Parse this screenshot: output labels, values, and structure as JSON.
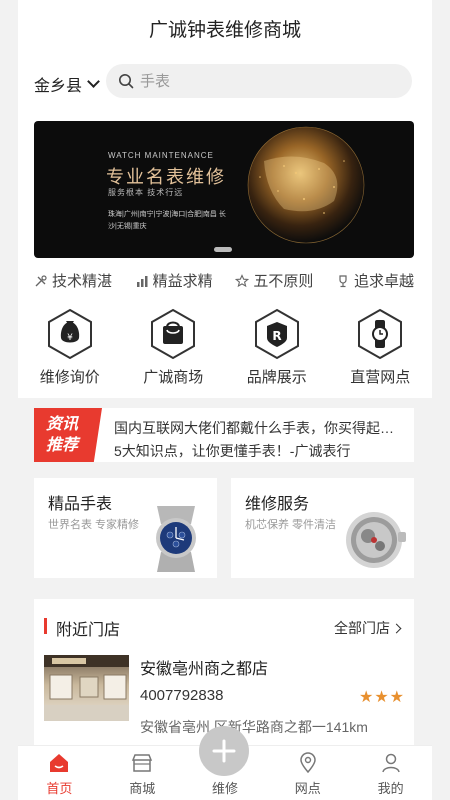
{
  "header": {
    "title": "广诚钟表维修商城"
  },
  "location": {
    "label": "金乡县"
  },
  "search": {
    "placeholder": "手表"
  },
  "banner": {
    "kicker": "WATCH MAINTENANCE",
    "title": "专业名表维修",
    "subtitle": "服务根本  技术行远",
    "cities": "珠海|广州|南宁|宁波|海口|合肥|南昌 长沙|无锡|重庆"
  },
  "features": [
    {
      "label": "技术精湛",
      "icon": "tools-icon"
    },
    {
      "label": "精益求精",
      "icon": "chart-icon"
    },
    {
      "label": "五不原则",
      "icon": "star-icon"
    },
    {
      "label": "追求卓越",
      "icon": "trophy-icon"
    }
  ],
  "quick_links": [
    {
      "label": "维修询价",
      "icon": "money-bag-icon"
    },
    {
      "label": "广诚商场",
      "icon": "shopping-bag-icon"
    },
    {
      "label": "品牌展示",
      "icon": "brand-r-icon"
    },
    {
      "label": "直营网点",
      "icon": "watch-icon"
    }
  ],
  "news": {
    "badge_line1": "资讯",
    "badge_line2": "推荐",
    "line1": "国内互联网大佬们都戴什么手表，你买得起…",
    "line2": "5大知识点，让你更懂手表！-广诚表行"
  },
  "cards": [
    {
      "title": "精品手表",
      "subtitle": "世界名表  专家精修"
    },
    {
      "title": "维修服务",
      "subtitle": "机芯保养  零件清洁"
    }
  ],
  "stores": {
    "title": "附近门店",
    "all_label": "全部门店",
    "item": {
      "name": "安徽亳州商之都店",
      "phone": "4007792838",
      "rating": 3,
      "address": "安徽省亳州  区新华路商之都一141km"
    }
  },
  "tabbar": [
    {
      "label": "首页",
      "icon": "home-icon",
      "active": true
    },
    {
      "label": "商城",
      "icon": "store-icon",
      "active": false
    },
    {
      "label": "维修",
      "icon": "plus-icon",
      "active": false
    },
    {
      "label": "网点",
      "icon": "location-pin-icon",
      "active": false
    },
    {
      "label": "我的",
      "icon": "user-icon",
      "active": false
    }
  ],
  "colors": {
    "accent": "#e83a2f",
    "star": "#e8902f",
    "banner_gold": "#e2c199"
  }
}
